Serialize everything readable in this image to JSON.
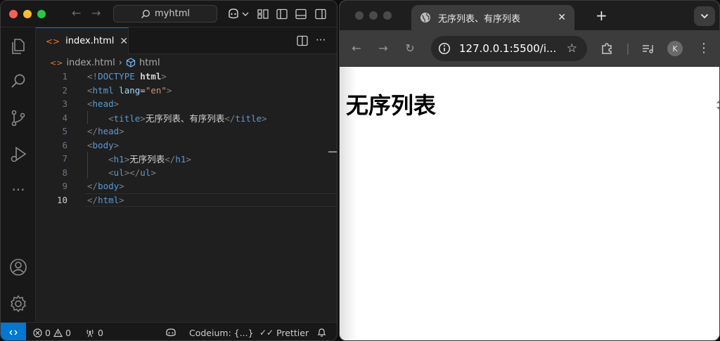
{
  "vscode": {
    "command_center": "myhtml",
    "tab": {
      "label": "index.html",
      "close": "✕"
    },
    "breadcrumb": {
      "file": "index.html",
      "symbol": "html",
      "separator": "›"
    },
    "code_lines": [
      {
        "n": "1",
        "tokens": [
          [
            "t-br",
            "<!"
          ],
          [
            "t-dt",
            "DOCTYPE"
          ],
          [
            "t-txt",
            " "
          ],
          [
            "t-kw",
            "html"
          ],
          [
            "t-br",
            ">"
          ]
        ]
      },
      {
        "n": "2",
        "tokens": [
          [
            "t-br",
            "<"
          ],
          [
            "t-tag",
            "html"
          ],
          [
            "t-txt",
            " "
          ],
          [
            "t-at",
            "lang"
          ],
          [
            "t-txt",
            "="
          ],
          [
            "t-str",
            "\"en\""
          ],
          [
            "t-br",
            ">"
          ]
        ]
      },
      {
        "n": "3",
        "tokens": [
          [
            "t-br",
            "<"
          ],
          [
            "t-tag",
            "head"
          ],
          [
            "t-br",
            ">"
          ]
        ]
      },
      {
        "n": "4",
        "tokens": [
          [
            "t-txt",
            "    "
          ],
          [
            "t-br",
            "<"
          ],
          [
            "t-tag",
            "title"
          ],
          [
            "t-br",
            ">"
          ],
          [
            "t-txt",
            "无序列表、有序列表"
          ],
          [
            "t-br",
            "</"
          ],
          [
            "t-tag",
            "title"
          ],
          [
            "t-br",
            ">"
          ]
        ]
      },
      {
        "n": "5",
        "tokens": [
          [
            "t-br",
            "</"
          ],
          [
            "t-tag",
            "head"
          ],
          [
            "t-br",
            ">"
          ]
        ]
      },
      {
        "n": "6",
        "tokens": [
          [
            "t-br",
            "<"
          ],
          [
            "t-tag",
            "body"
          ],
          [
            "t-br",
            ">"
          ]
        ]
      },
      {
        "n": "7",
        "tokens": [
          [
            "t-txt",
            "    "
          ],
          [
            "t-br",
            "<"
          ],
          [
            "t-tag",
            "h1"
          ],
          [
            "t-br",
            ">"
          ],
          [
            "t-txt",
            "无序列表"
          ],
          [
            "t-br",
            "</"
          ],
          [
            "t-tag",
            "h1"
          ],
          [
            "t-br",
            ">"
          ]
        ]
      },
      {
        "n": "8",
        "tokens": [
          [
            "t-txt",
            "    "
          ],
          [
            "t-br",
            "<"
          ],
          [
            "t-tag",
            "ul"
          ],
          [
            "t-br",
            "></"
          ],
          [
            "t-tag",
            "ul"
          ],
          [
            "t-br",
            ">"
          ]
        ]
      },
      {
        "n": "9",
        "tokens": [
          [
            "t-br",
            "</"
          ],
          [
            "t-tag",
            "body"
          ],
          [
            "t-br",
            ">"
          ]
        ]
      },
      {
        "n": "10",
        "tokens": [
          [
            "t-br",
            "</"
          ],
          [
            "t-tag",
            "html"
          ],
          [
            "t-br",
            ">"
          ]
        ]
      }
    ],
    "active_line": "10",
    "status": {
      "errors": "0",
      "warnings": "0",
      "ports": "0",
      "codeium": "Codeium: {...}",
      "prettier": "Prettier"
    }
  },
  "chrome": {
    "tab_title": "无序列表、有序列表",
    "tab_close": "✕",
    "new_tab": "+",
    "url": "127.0.0.1:5500/i...",
    "profile_initial": "K",
    "page_heading": "无序列表"
  },
  "colors": {
    "vscode_accent": "#0078d4",
    "tag": "#569cd6",
    "attr": "#9cdcfe",
    "string": "#ce9178"
  }
}
